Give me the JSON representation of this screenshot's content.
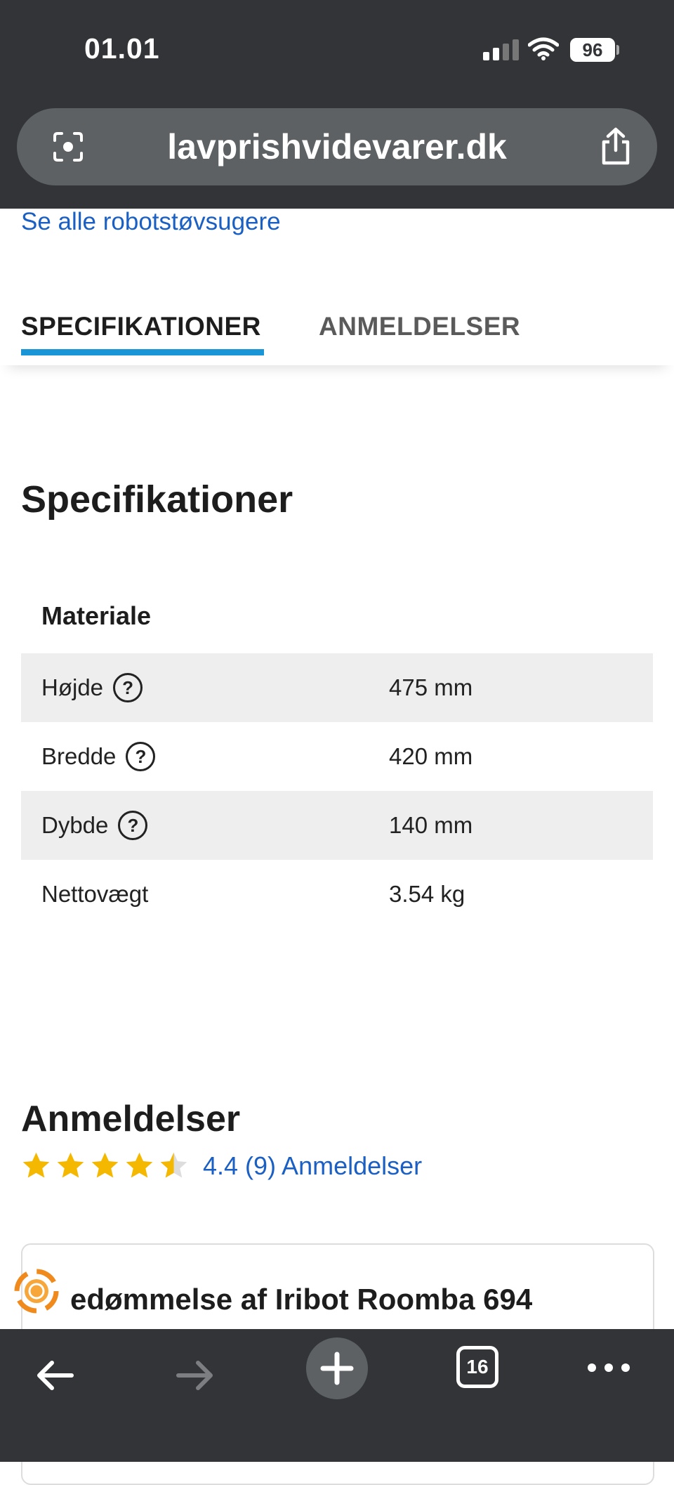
{
  "status_bar": {
    "time": "01.01",
    "battery": "96"
  },
  "browser": {
    "url": "lavprishvidevarer.dk",
    "tab_count": "16"
  },
  "page": {
    "see_all_link": "Se alle robotstøvsugere",
    "tabs": [
      {
        "label": "SPECIFIKATIONER",
        "active": true
      },
      {
        "label": "ANMELDELSER",
        "active": false
      }
    ],
    "spec_heading": "Specifikationer",
    "spec_group": "Materiale",
    "specs": [
      {
        "label": "Højde",
        "value": "475 mm",
        "help": true
      },
      {
        "label": "Bredde",
        "value": "420 mm",
        "help": true
      },
      {
        "label": "Dybde",
        "value": "140 mm",
        "help": true
      },
      {
        "label": "Nettovægt",
        "value": "3.54 kg",
        "help": false
      }
    ],
    "help_glyph": "?",
    "reviews_heading": "Anmeldelser",
    "rating": {
      "value": 4.4,
      "max": 5,
      "text": "4.4 (9) Anmeldelser"
    },
    "review_card_title": "edømmelse af Iribot Roomba 694"
  },
  "colors": {
    "bar_bg": "#323437",
    "link": "#1a5fc4",
    "tab_accent": "#1a95d6",
    "star": "#f5b800"
  }
}
